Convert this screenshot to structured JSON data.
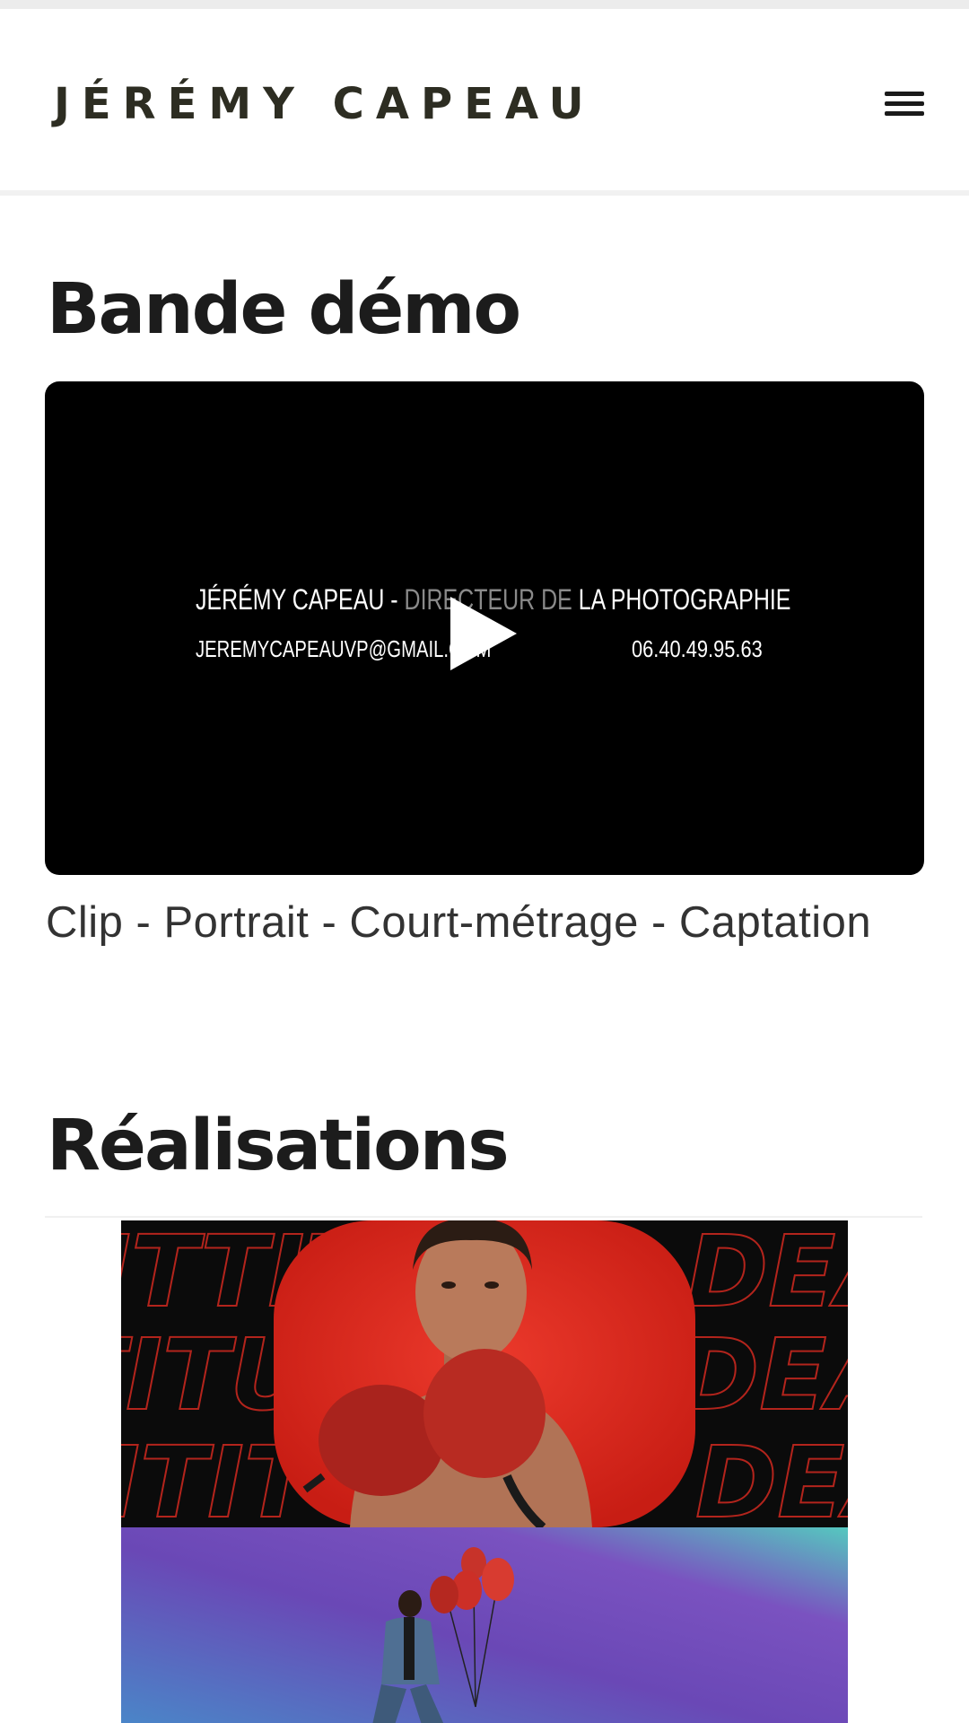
{
  "header": {
    "brand": "JÉRÉMY CAPEAU",
    "menu_icon": "hamburger-menu-icon"
  },
  "demo_section": {
    "title": "Bande démo",
    "video": {
      "line1_name": "JÉRÉMY CAPEAU - ",
      "line1_role_dim": "DIRECTEUR DE ",
      "line1_role": "LA PHOTOGRAPHIE",
      "email": "JEREMYCAPEAUVP@GMAIL.COM",
      "phone": "06.40.49.95.63",
      "play_icon": "play-icon"
    },
    "caption": "Clip - Portrait - Court-métrage - Captation"
  },
  "realisations_section": {
    "title": "Réalisations",
    "items": [
      {
        "name": "boxing-portrait-thumbnail",
        "background_word": "ATTITUDE"
      },
      {
        "name": "balloons-portrait-thumbnail"
      }
    ]
  },
  "colors": {
    "brand_text": "#2d2d22",
    "heading": "#1c1c1c",
    "video_bg": "#000000",
    "boxing_red": "#e0281e",
    "gradient_purple": "#6a3fb8",
    "gradient_teal": "#58c9c0"
  }
}
